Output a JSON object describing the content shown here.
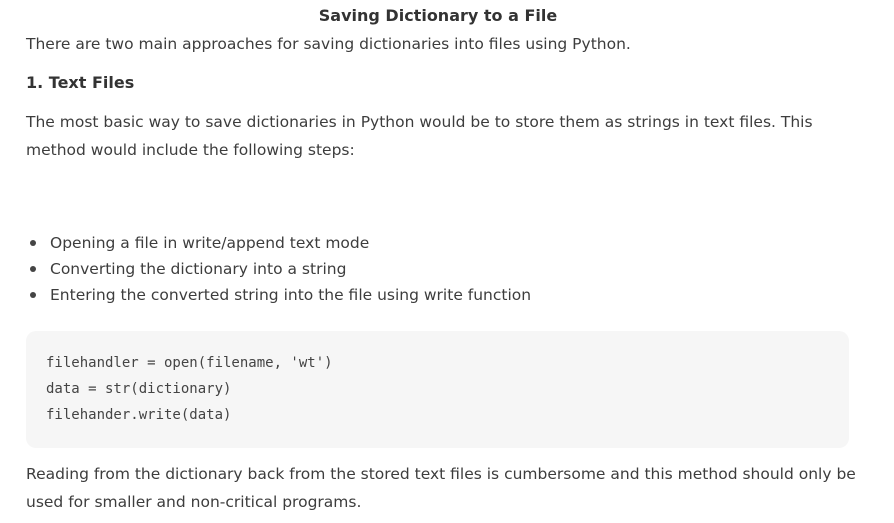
{
  "document": {
    "title": "Saving Dictionary to a File",
    "intro": "There are two main approaches for saving dictionaries into files using Python.",
    "section_heading": "1. Text Files",
    "paragraph_1": "The most basic way to save dictionaries in Python would be to store them as strings in text files. This method would include the following steps:",
    "steps": [
      "Opening a file in write/append text mode",
      "Converting the dictionary into a string",
      "Entering the converted string into the file using write function"
    ],
    "code_lines": [
      "filehandler = open(filename, 'wt')",
      "data = str(dictionary)",
      "filehander.write(data)"
    ],
    "paragraph_2": "Reading from the dictionary back from the stored text files is cumbersome and this method should only be used for smaller and non-critical programs."
  }
}
